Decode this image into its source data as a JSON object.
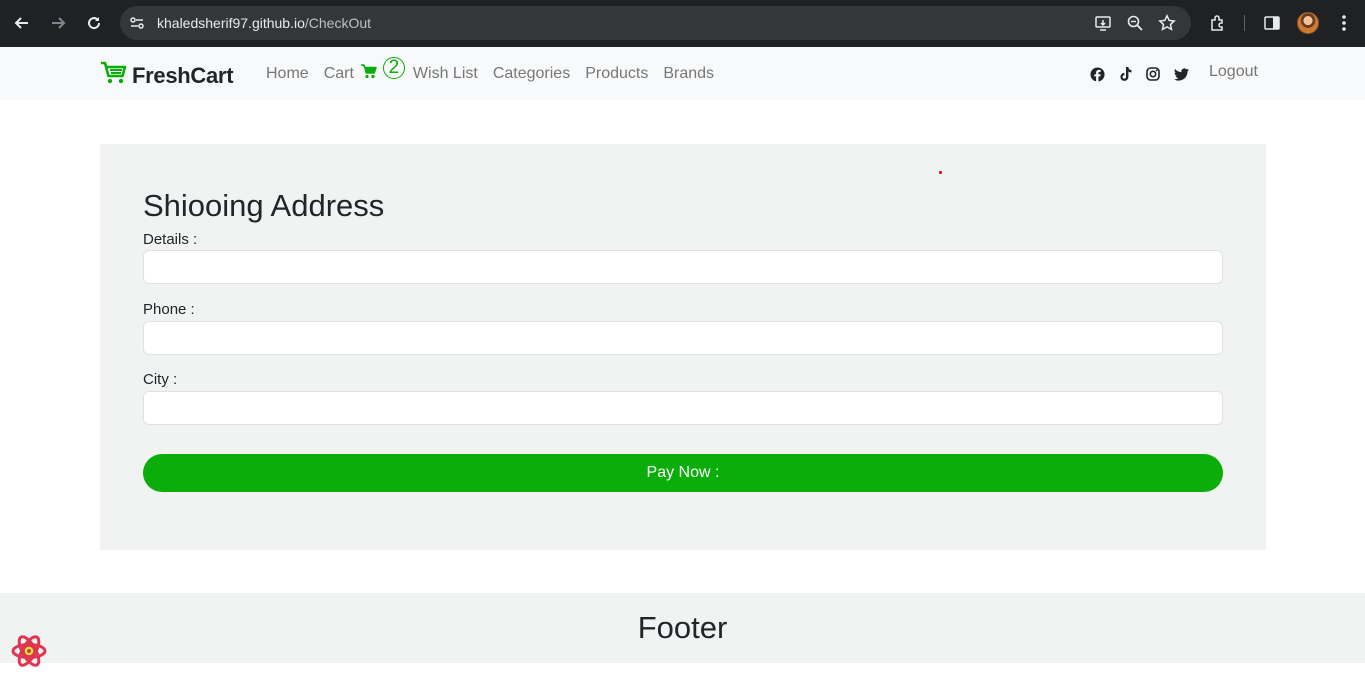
{
  "browser": {
    "url_host": "khaledsherif97.github.io",
    "url_path": "/CheckOut",
    "icons": [
      "back-icon",
      "forward-icon",
      "reload-icon",
      "site-settings-icon",
      "install-app-icon",
      "zoom-icon",
      "bookmark-star-icon",
      "extensions-icon",
      "side-panel-icon",
      "profile-avatar",
      "more-menu-icon"
    ]
  },
  "navbar": {
    "brand": "FreshCart",
    "links": {
      "home": "Home",
      "cart": "Cart",
      "wish_list": "Wish List",
      "categories": "Categories",
      "products": "Products",
      "brands": "Brands"
    },
    "cart_count": "2",
    "social_icons": [
      "facebook-icon",
      "tiktok-icon",
      "instagram-icon",
      "twitter-icon"
    ],
    "logout": "Logout"
  },
  "form": {
    "title": "Shiooing Address",
    "details_label": "Details :",
    "details_value": "",
    "phone_label": "Phone :",
    "phone_value": "",
    "city_label": "City :",
    "city_value": "",
    "submit_label": "Pay Now :"
  },
  "footer": {
    "title": "Footer"
  },
  "colors": {
    "accent": "#0aad0a",
    "card_bg": "#f0f3f2",
    "nav_bg": "#f8f9fa",
    "text": "#212529",
    "muted": "#777777"
  }
}
